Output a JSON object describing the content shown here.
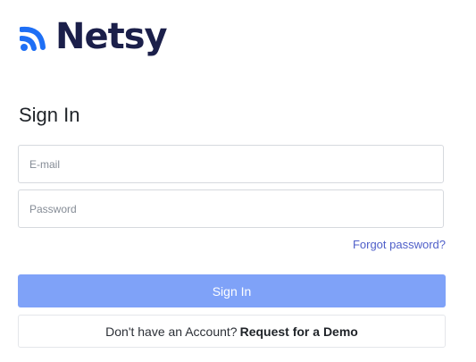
{
  "brand": {
    "name": "Netsy",
    "mark_color": "#1e6ff5",
    "text_color": "#1b1f4a"
  },
  "form": {
    "title": "Sign In",
    "email_placeholder": "E-mail",
    "password_placeholder": "Password",
    "forgot_label": "Forgot password?",
    "submit_label": "Sign In"
  },
  "signup": {
    "prompt": "Don't have an Account?",
    "link_label": "Request for a Demo"
  },
  "colors": {
    "primary_button": "#7fa2f8",
    "link": "#4f5fc9"
  }
}
